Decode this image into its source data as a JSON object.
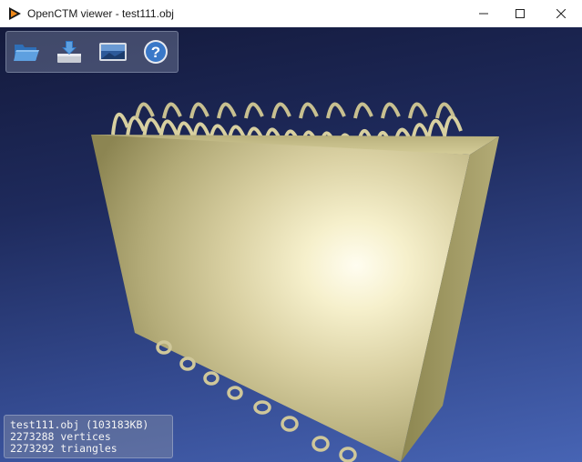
{
  "window": {
    "title": "OpenCTM viewer - test111.obj",
    "controls": {
      "minimize": "minimize-icon",
      "maximize": "maximize-icon",
      "close": "close-icon"
    }
  },
  "toolbar": {
    "buttons": [
      {
        "name": "open",
        "icon": "folder-open-icon"
      },
      {
        "name": "save",
        "icon": "save-tray-icon"
      },
      {
        "name": "snapshot",
        "icon": "screenshot-icon"
      },
      {
        "name": "help",
        "icon": "help-icon",
        "glyph": "?"
      }
    ]
  },
  "model": {
    "description_icon": "3d-model-render",
    "colors": {
      "body_light": "#fffbe6",
      "body_mid": "#d8d0a0",
      "body_dark": "#8a8450",
      "background": "#2a3a7a"
    }
  },
  "info": {
    "file_line": "test111.obj (103183KB)",
    "vertices_line": "2273288 vertices",
    "triangles_line": "2273292 triangles"
  }
}
